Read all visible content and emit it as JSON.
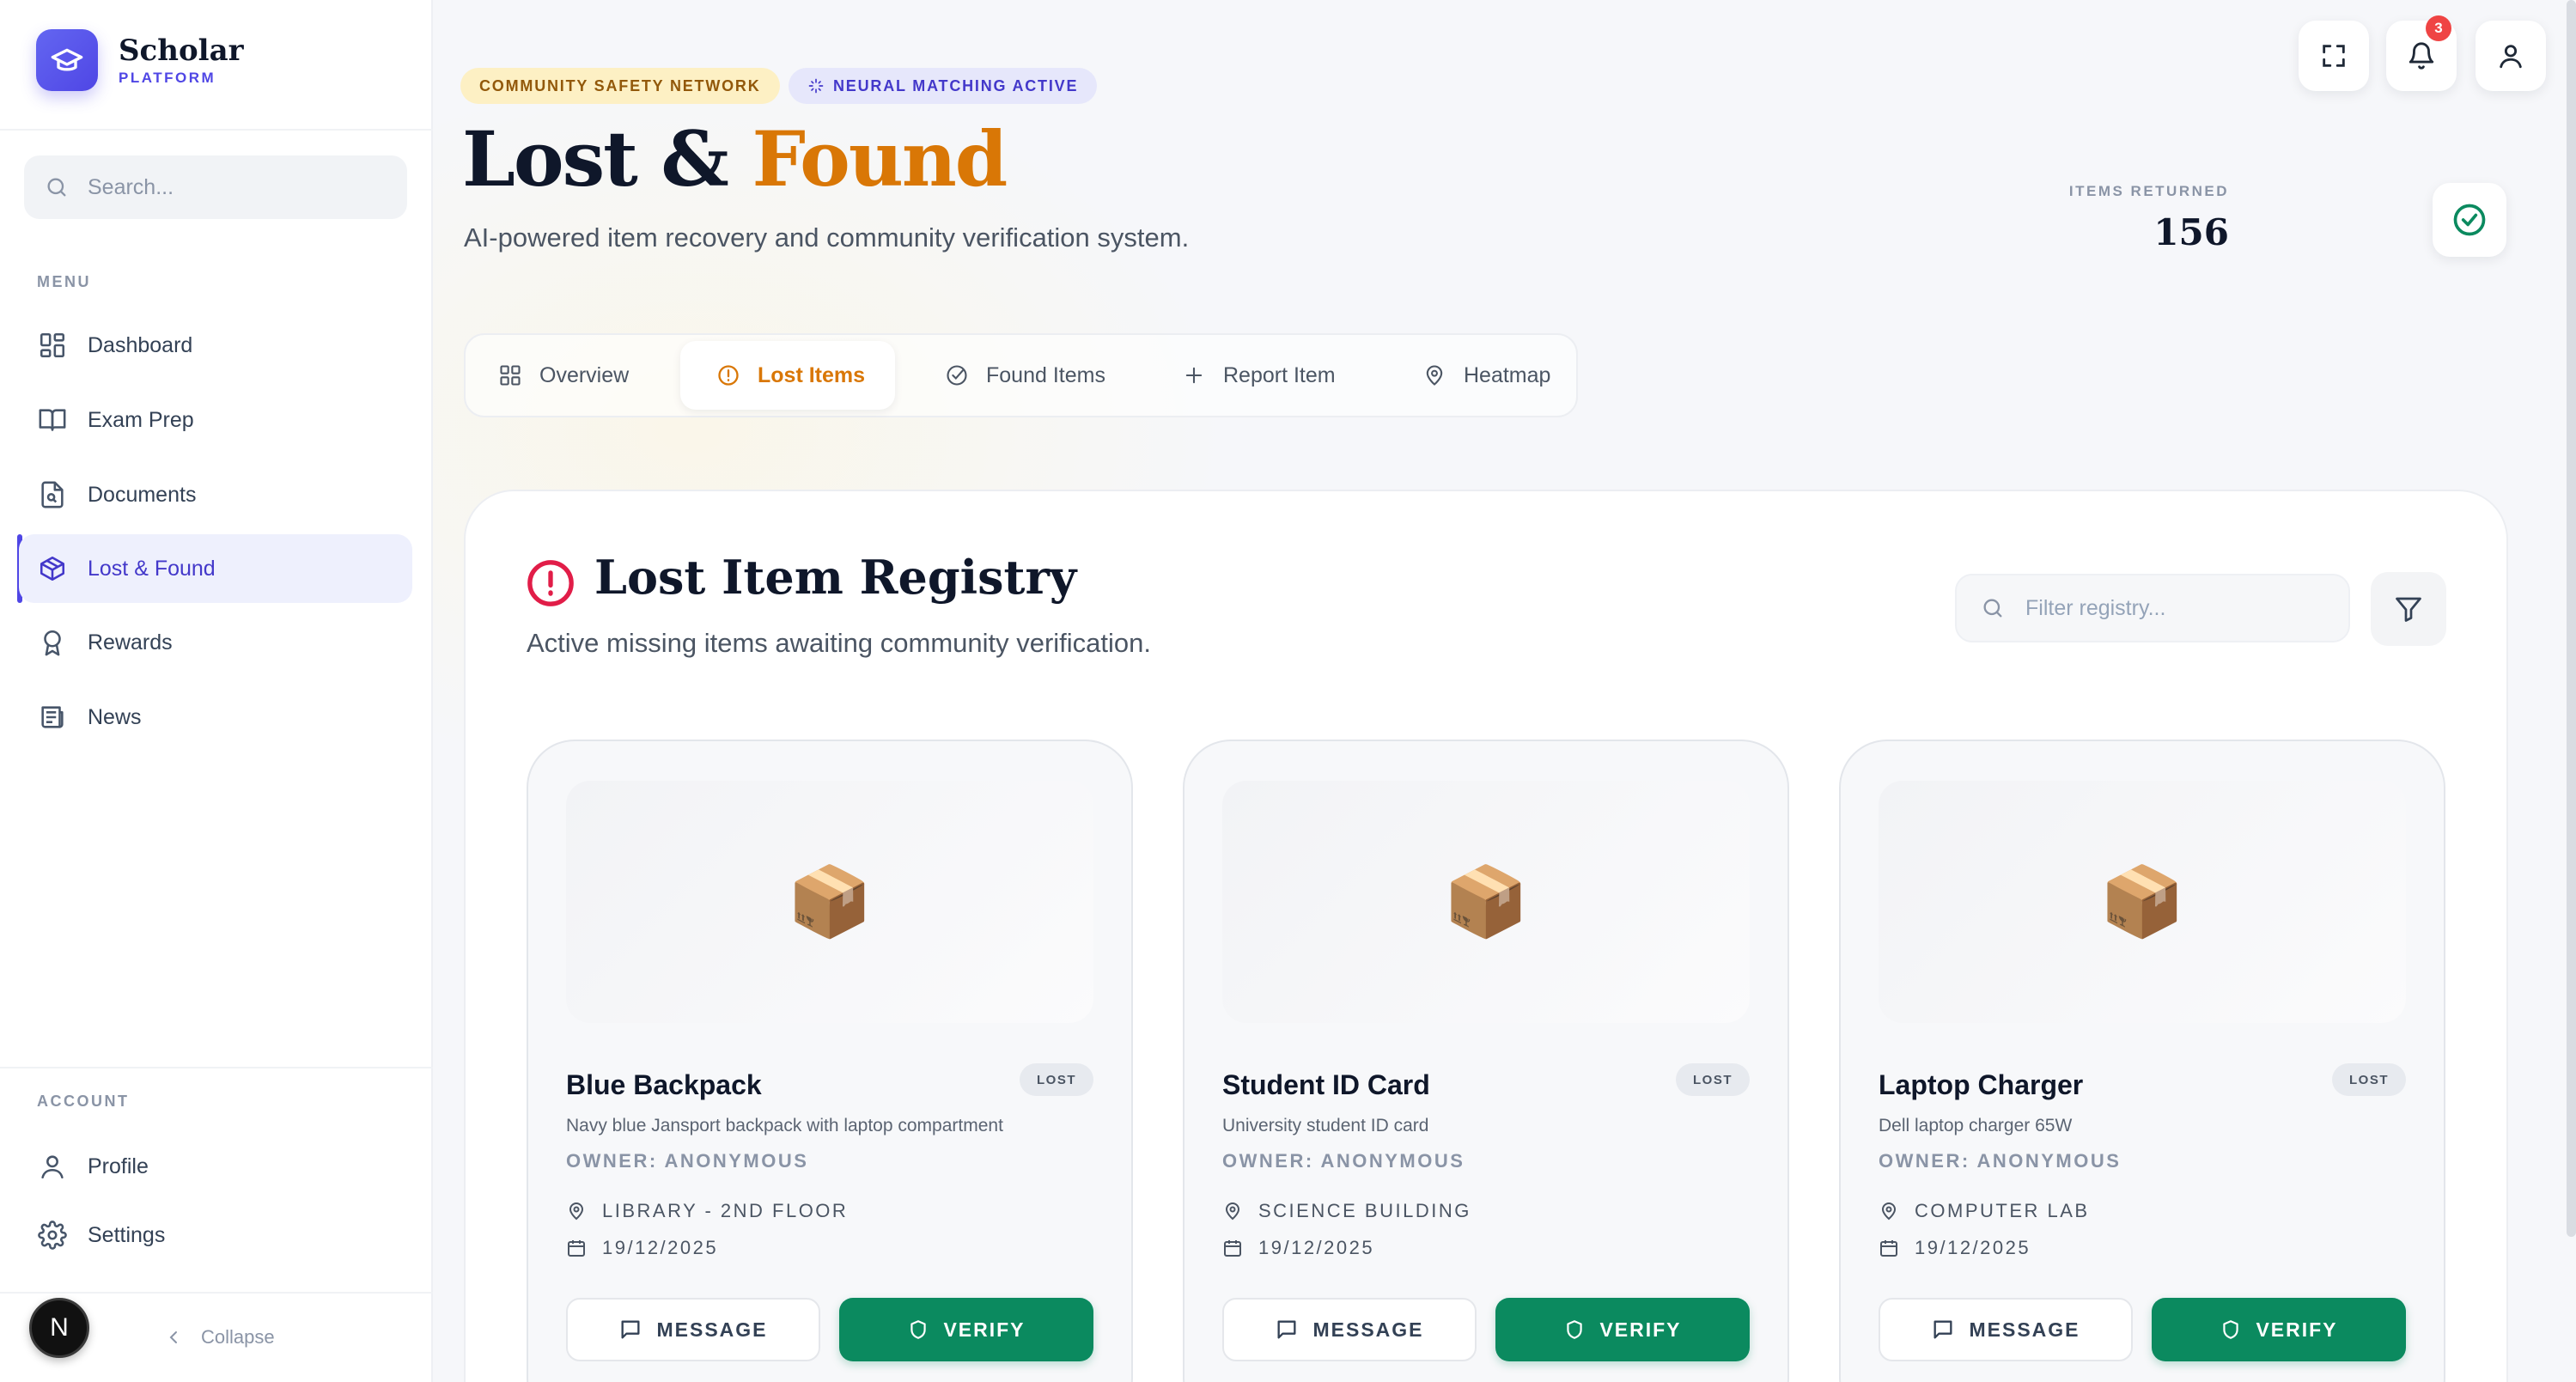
{
  "brand": {
    "name": "Scholar",
    "subtitle": "PLATFORM"
  },
  "sidebar": {
    "search_placeholder": "Search...",
    "menu_heading": "MENU",
    "items": [
      {
        "label": "Dashboard",
        "icon": "dashboard-icon"
      },
      {
        "label": "Exam Prep",
        "icon": "book-icon"
      },
      {
        "label": "Documents",
        "icon": "documents-icon"
      },
      {
        "label": "Lost & Found",
        "icon": "package-icon",
        "active": true
      },
      {
        "label": "Rewards",
        "icon": "award-icon"
      },
      {
        "label": "News",
        "icon": "newspaper-icon"
      }
    ],
    "account_heading": "ACCOUNT",
    "account_items": [
      {
        "label": "Profile",
        "icon": "user-icon"
      },
      {
        "label": "Settings",
        "icon": "gear-icon"
      }
    ],
    "avatar_initial": "N",
    "collapse_label": "Collapse"
  },
  "header": {
    "pill_safety": "COMMUNITY SAFETY NETWORK",
    "pill_neural": "NEURAL MATCHING ACTIVE",
    "title_part1": "Lost & ",
    "title_part2": "Found",
    "subtitle": "AI-powered item recovery and community verification system.",
    "notification_count": "3",
    "stat_label": "ITEMS RETURNED",
    "stat_value": "156"
  },
  "tabs": [
    {
      "label": "Overview",
      "icon": "grid-icon"
    },
    {
      "label": "Lost Items",
      "icon": "alert-circle-icon",
      "active": true
    },
    {
      "label": "Found Items",
      "icon": "check-circle-icon"
    },
    {
      "label": "Report Item",
      "icon": "plus-icon"
    },
    {
      "label": "Heatmap",
      "icon": "map-pin-icon"
    }
  ],
  "registry": {
    "title": "Lost Item Registry",
    "subtitle": "Active missing items awaiting community verification.",
    "filter_placeholder": "Filter registry..."
  },
  "cards": [
    {
      "title": "Blue Backpack",
      "badge": "LOST",
      "description": "Navy blue Jansport backpack with laptop compartment",
      "owner": "OWNER: ANONYMOUS",
      "location": "LIBRARY - 2ND FLOOR",
      "date": "19/12/2025",
      "message_label": "MESSAGE",
      "verify_label": "VERIFY",
      "emoji": "📦"
    },
    {
      "title": "Student ID Card",
      "badge": "LOST",
      "description": "University student ID card",
      "owner": "OWNER: ANONYMOUS",
      "location": "SCIENCE BUILDING",
      "date": "19/12/2025",
      "message_label": "MESSAGE",
      "verify_label": "VERIFY",
      "emoji": "📦"
    },
    {
      "title": "Laptop Charger",
      "badge": "LOST",
      "description": "Dell laptop charger 65W",
      "owner": "OWNER: ANONYMOUS",
      "location": "COMPUTER LAB",
      "date": "19/12/2025",
      "message_label": "MESSAGE",
      "verify_label": "VERIFY",
      "emoji": "📦"
    }
  ],
  "colors": {
    "accent": "#d97706",
    "brand": "#4f46e5",
    "verify": "#0b8a5f",
    "alert": "#e11d48",
    "badge_notification": "#ef4444"
  }
}
